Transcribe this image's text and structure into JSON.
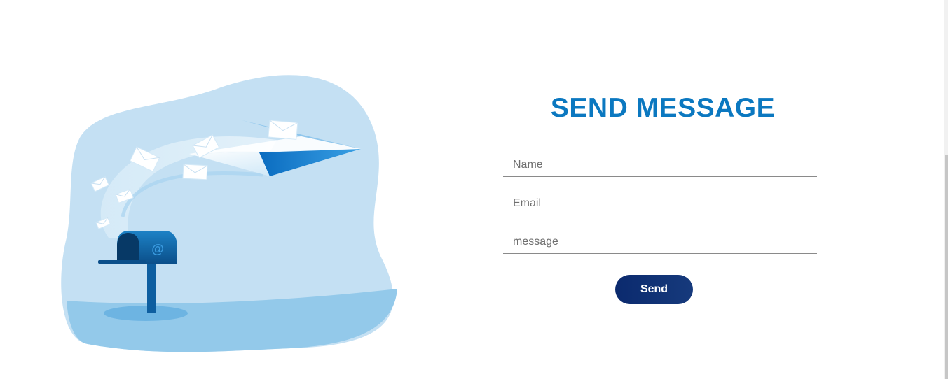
{
  "form": {
    "title": "SEND MESSAGE",
    "name_placeholder": "Name",
    "email_placeholder": "Email",
    "message_placeholder": "message",
    "send_label": "Send"
  },
  "illustration": {
    "icons": [
      "mailbox-icon",
      "paper-plane-icon",
      "envelope-icon"
    ],
    "mailbox_symbol": "@"
  },
  "colors": {
    "title": "#0b78c0",
    "button": "#0b2a6e",
    "blob": "#c4e0f3",
    "ground": "#93c9ea"
  }
}
